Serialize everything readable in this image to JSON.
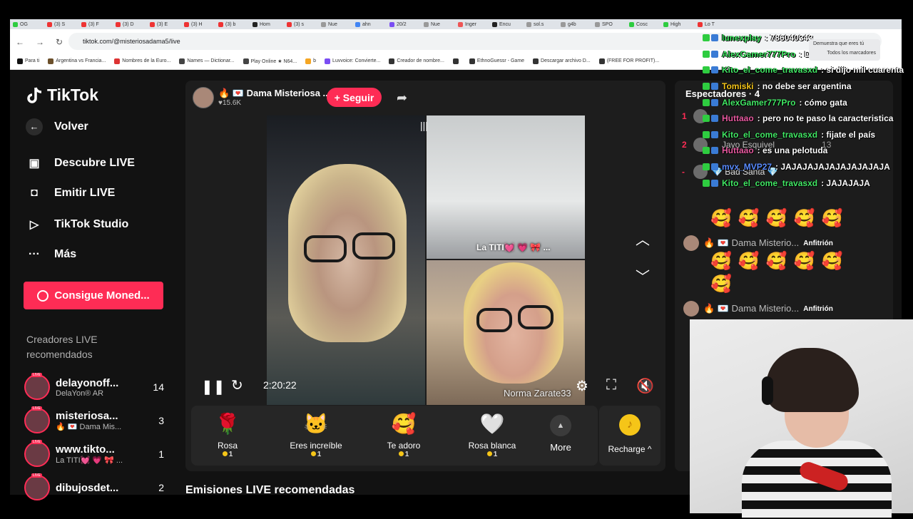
{
  "browser": {
    "tabs": [
      "OG",
      "(3) S",
      "(3) F",
      "(3) D",
      "(3) E",
      "(3) H",
      "(3) b",
      "Hom",
      "(3) s",
      "Nue",
      "ahn",
      "20/2",
      "Nue",
      "Inger",
      "Encu",
      "sol.s",
      "g4b",
      "SPO",
      "Cosc",
      "High",
      "Lo T"
    ],
    "url": "tiktok.com/@misteriosadama5/live",
    "bookmarks": [
      "Para ti",
      "Argentina vs Francia...",
      "Nombres de la Euro...",
      "Names — Dictionar...",
      "Play Online ★ N64...",
      "b",
      "Luvvoice: Convierte...",
      "Creador de nombre...",
      "",
      "EthnoGuessr - Game",
      "Descargar archivo D...",
      "(FREE FOR PROFIT)..."
    ],
    "verify_popup": "Demuestra que eres tú",
    "all_bookmarks": "Todos los marcadores"
  },
  "sidebar": {
    "logo": "TikTok",
    "back": "Volver",
    "nav": [
      {
        "label": "Descubre LIVE",
        "icon": "live-tv-icon"
      },
      {
        "label": "Emitir LIVE",
        "icon": "camera-icon"
      },
      {
        "label": "TikTok Studio",
        "icon": "studio-icon"
      },
      {
        "label": "Más",
        "icon": "more-dots-icon"
      }
    ],
    "coins_button": "Consigue Moned...",
    "recommended_title": "Creadores LIVE recomendados",
    "live_badge": "LIVE",
    "creators": [
      {
        "name": "delayonoff...",
        "sub": "DelaYon® AR",
        "count": "14"
      },
      {
        "name": "misteriosa...",
        "sub": "🔥 💌 Dama Mis...",
        "count": "3"
      },
      {
        "name": "www.tikto...",
        "sub": "La TITI💓 💗 🎀 ...",
        "count": "1"
      },
      {
        "name": "dibujosdet...",
        "sub": "",
        "count": "2"
      }
    ]
  },
  "player": {
    "host_name": "🔥 💌 Dama Misteriosa ...",
    "host_viewers": "♥15.6K",
    "follow": "+ Seguir",
    "cohost_top": "La TITI💓 💗 🎀 ...",
    "cohost_bottom": "Norma Zarate33",
    "timer": "2:20:22",
    "section_title": "Emisiones LIVE recomendadas"
  },
  "gifts": [
    {
      "name": "Rosa",
      "price": "1",
      "icon": "🌹"
    },
    {
      "name": "Eres increíble",
      "price": "1",
      "icon": "🐱"
    },
    {
      "name": "Te adoro",
      "price": "1",
      "icon": "🥰"
    },
    {
      "name": "Rosa blanca",
      "price": "1",
      "icon": "🤍"
    }
  ],
  "gift_more": "More",
  "recharge": "Recharge ^",
  "chatpanel": {
    "viewers_title": "Espectadores · 4",
    "viewers": [
      {
        "rank": "1",
        "name": "",
        "count": ""
      },
      {
        "rank": "2",
        "name": "Jayo Esquivel",
        "count": "13"
      },
      {
        "rank": "-",
        "name": "💎 Bad Santa 💎",
        "count": ""
      }
    ],
    "host_label": "🔥 💌 Dama Misterio...",
    "host_tag": "Anfitrión"
  },
  "stream_chat": [
    {
      "user": "lunexplay",
      "msg": ": 786040343",
      "color": "#42e865"
    },
    {
      "user": "AlexGamer777Pro",
      "msg": ": Dou",
      "color": "#42e865"
    },
    {
      "user": "Kito_el_come_travasxd",
      "msg": ": si dijo mil cuarenta",
      "color": "#42e865"
    },
    {
      "user": "Tomiski",
      "msg": ": no debe ser argentina",
      "color": "#f5c518"
    },
    {
      "user": "AlexGamer777Pro",
      "msg": ": cómo gata",
      "color": "#42e865"
    },
    {
      "user": "Huttaao",
      "msg": ": pero no te paso la caracteristica",
      "color": "#e85aa0"
    },
    {
      "user": "Kito_el_come_travasxd",
      "msg": ": fijate el país",
      "color": "#42e865"
    },
    {
      "user": "Huttaao",
      "msg": ": es una pelotuda",
      "color": "#e85aa0"
    },
    {
      "user": "mvx_MVP27",
      "msg": ": JAJAJAJAJAJAJAJAJAJA",
      "color": "#5a8cff"
    },
    {
      "user": "Kito_el_come_travasxd",
      "msg": ": JAJAJAJA",
      "color": "#42e865"
    }
  ]
}
